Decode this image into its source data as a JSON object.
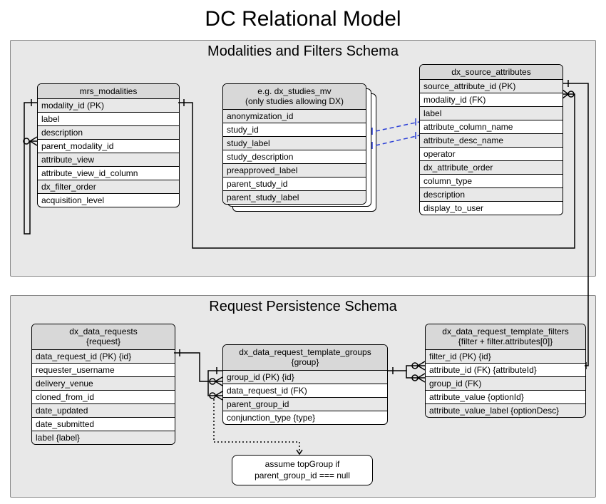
{
  "title": "DC Relational Model",
  "schemas": {
    "top": {
      "title": "Modalities and Filters Schema"
    },
    "bottom": {
      "title": "Request Persistence Schema"
    }
  },
  "entities": {
    "mrs_modalities": {
      "name": "mrs_modalities",
      "rows": [
        "modality_id (PK)",
        "label",
        "description",
        "parent_modality_id",
        "attribute_view",
        "attribute_view_id_column",
        "dx_filter_order",
        "acquisition_level"
      ]
    },
    "dx_studies_mv": {
      "name_l1": "e.g. dx_studies_mv",
      "name_l2": "(only studies allowing DX)",
      "rows": [
        "anonymization_id",
        "study_id",
        "study_label",
        "study_description",
        "preapproved_label",
        "parent_study_id",
        "parent_study_label"
      ]
    },
    "dx_source_attributes": {
      "name": "dx_source_attributes",
      "rows": [
        "source_attribute_id (PK)",
        "modality_id (FK)",
        "label",
        "attribute_column_name",
        "attribute_desc_name",
        "operator",
        "dx_attribute_order",
        "column_type",
        "description",
        "display_to_user"
      ]
    },
    "dx_data_requests": {
      "name_l1": "dx_data_requests",
      "name_l2": "{request}",
      "rows": [
        "data_request_id (PK) {id}",
        "requester_username",
        "delivery_venue",
        "cloned_from_id",
        "date_updated",
        "date_submitted",
        "label {label}"
      ]
    },
    "dx_data_request_template_groups": {
      "name_l1": "dx_data_request_template_groups",
      "name_l2": "{group}",
      "rows": [
        "group_id (PK) {id}",
        "data_request_id (FK)",
        "parent_group_id",
        "conjunction_type {type}"
      ]
    },
    "dx_data_request_template_filters": {
      "name_l1": "dx_data_request_template_filters",
      "name_l2": "{filter + filter.attributes[0]}",
      "rows": [
        "filter_id (PK) {id}",
        "attribute_id (FK) {attributeId}",
        "group_id (FK)",
        "attribute_value {optionId}",
        "attribute_value_label {optionDesc}"
      ]
    }
  },
  "note": {
    "line1": "assume topGroup if",
    "line2": "parent_group_id === null"
  }
}
